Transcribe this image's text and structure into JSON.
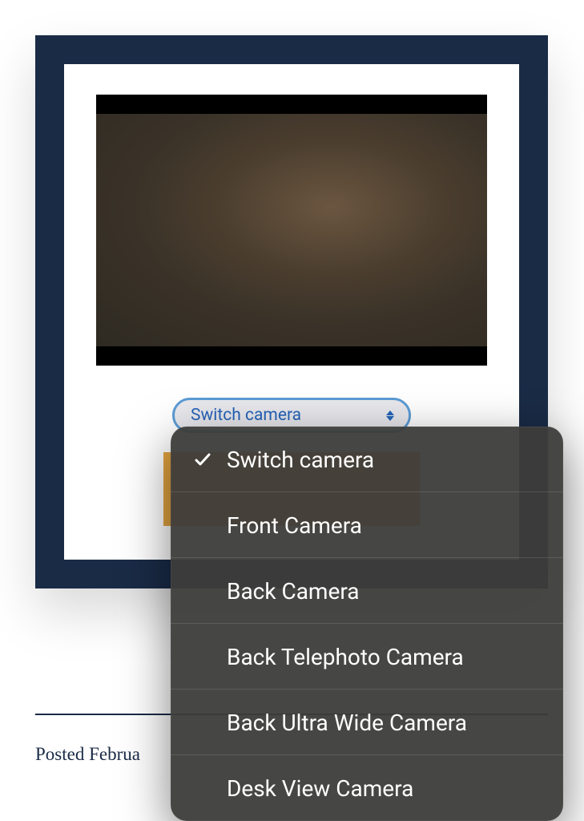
{
  "cameraSelect": {
    "selectedLabel": "Switch camera",
    "options": [
      {
        "label": "Switch camera",
        "selected": true
      },
      {
        "label": "Front Camera",
        "selected": false
      },
      {
        "label": "Back Camera",
        "selected": false
      },
      {
        "label": "Back Telephoto Camera",
        "selected": false
      },
      {
        "label": "Back Ultra Wide Camera",
        "selected": false
      },
      {
        "label": "Desk View Camera",
        "selected": false
      }
    ]
  },
  "postLine": {
    "textVisible": "Posted Februa"
  }
}
